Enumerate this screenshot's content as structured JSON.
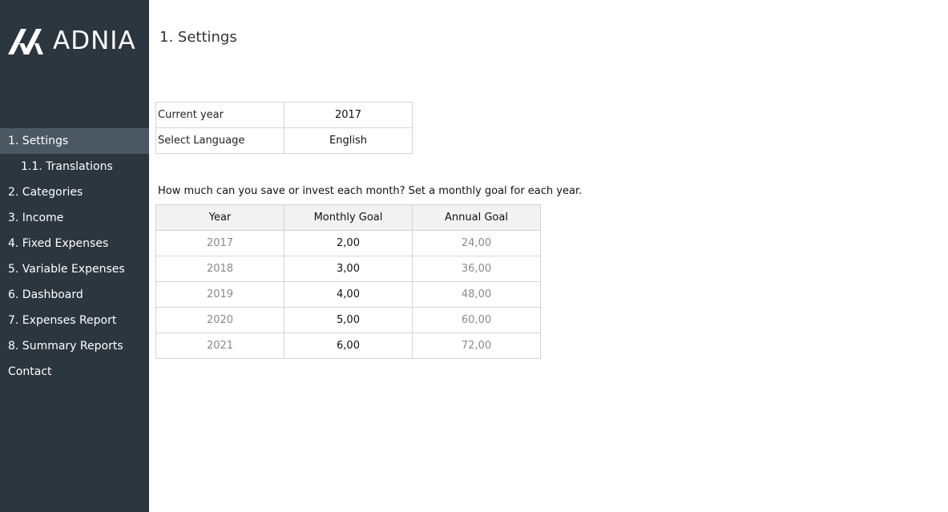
{
  "brand": {
    "name": "ADNIA"
  },
  "sidebar": {
    "items": [
      {
        "label": "1. Settings"
      },
      {
        "label": "1.1. Translations"
      },
      {
        "label": "2. Categories"
      },
      {
        "label": "3. Income"
      },
      {
        "label": "4. Fixed Expenses"
      },
      {
        "label": "5. Variable Expenses"
      },
      {
        "label": "6. Dashboard"
      },
      {
        "label": "7. Expenses Report"
      },
      {
        "label": "8. Summary Reports"
      },
      {
        "label": "Contact"
      }
    ],
    "active_index": 0
  },
  "main": {
    "title": "1. Settings",
    "settings": [
      {
        "label": "Current year",
        "value": "2017"
      },
      {
        "label": "Select Language",
        "value": "English"
      }
    ],
    "question": "How much can you save or invest each month? Set a monthly goal for each year.",
    "goals": {
      "headers": [
        "Year",
        "Monthly Goal",
        "Annual Goal"
      ],
      "rows": [
        {
          "year": "2017",
          "monthly": "2,00",
          "annual": "24,00"
        },
        {
          "year": "2018",
          "monthly": "3,00",
          "annual": "36,00"
        },
        {
          "year": "2019",
          "monthly": "4,00",
          "annual": "48,00"
        },
        {
          "year": "2020",
          "monthly": "5,00",
          "annual": "60,00"
        },
        {
          "year": "2021",
          "monthly": "6,00",
          "annual": "72,00"
        }
      ]
    }
  },
  "colors": {
    "sidebar_bg": "#2c363f",
    "sidebar_active": "#4b5863",
    "header_bg": "#f2f2f2",
    "muted_text": "#8a8a8a"
  }
}
